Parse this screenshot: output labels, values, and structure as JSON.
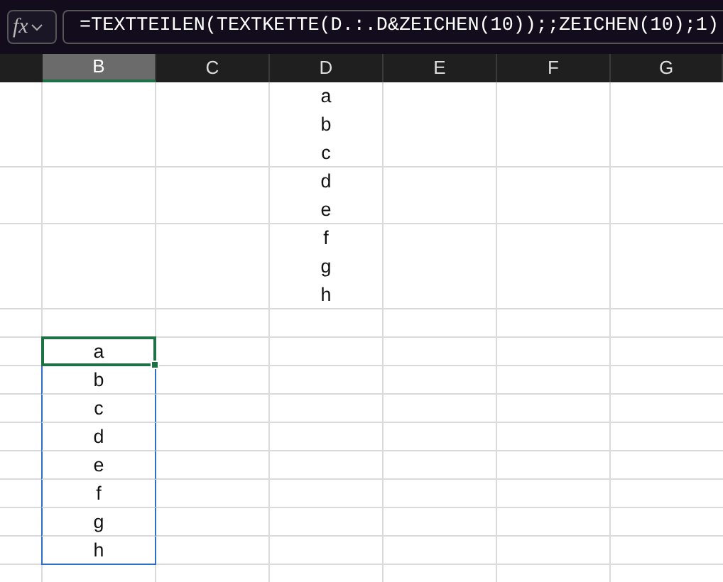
{
  "formula_bar": {
    "function_button": "fx",
    "formula": "=TEXTTEILEN(TEXTKETTE(D.:.D&ZEICHEN(10));;ZEICHEN(10);1)"
  },
  "columns": [
    {
      "label": "B",
      "selected": true
    },
    {
      "label": "C",
      "selected": false
    },
    {
      "label": "D",
      "selected": false
    },
    {
      "label": "E",
      "selected": false
    },
    {
      "label": "F",
      "selected": false
    },
    {
      "label": "G",
      "selected": false
    }
  ],
  "rows": [
    {
      "column_d": [
        "a",
        "b",
        "c"
      ]
    },
    {
      "column_d": [
        "d",
        "e"
      ]
    },
    {
      "column_d": [
        "f",
        "g",
        "h"
      ]
    },
    {},
    {
      "column_b": {
        "text": "a",
        "selected": true,
        "spill": true
      }
    },
    {
      "column_b": {
        "text": "b",
        "selected": false,
        "spill": true
      }
    },
    {
      "column_b": {
        "text": "c",
        "selected": false,
        "spill": true
      }
    },
    {
      "column_b": {
        "text": "d",
        "selected": false,
        "spill": true
      }
    },
    {
      "column_b": {
        "text": "e",
        "selected": false,
        "spill": true
      }
    },
    {
      "column_b": {
        "text": "f",
        "selected": false,
        "spill": true
      }
    },
    {
      "column_b": {
        "text": "g",
        "selected": false,
        "spill": true
      }
    },
    {
      "column_b": {
        "text": "h",
        "selected": false,
        "spill": true
      }
    },
    {}
  ]
}
